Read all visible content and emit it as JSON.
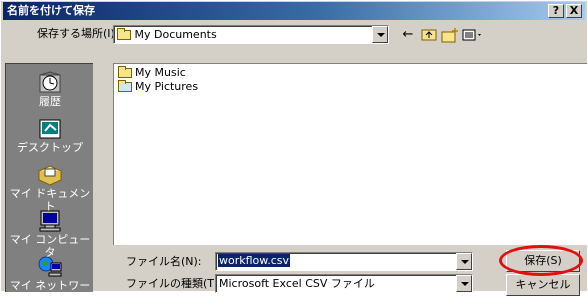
{
  "window": {
    "title": "名前を付けて保存",
    "help_button": "?",
    "close_button": "X"
  },
  "lookin": {
    "label": "保存する場所(I):",
    "value": "My Documents"
  },
  "toolbar": {
    "back_icon": "←",
    "up_folder_icon": "up-folder-icon",
    "new_folder_icon": "new-folder-icon",
    "views_icon": "views-icon"
  },
  "places": [
    {
      "label": "履歴",
      "icon": "history-icon"
    },
    {
      "label": "デスクトップ",
      "icon": "desktop-icon"
    },
    {
      "label": "マイ ドキュメント",
      "icon": "my-documents-icon"
    },
    {
      "label": "マイ コンピュータ",
      "icon": "my-computer-icon"
    },
    {
      "label": "マイ ネットワーク",
      "icon": "my-network-icon"
    }
  ],
  "files": [
    {
      "name": "My Music",
      "icon": "folder-icon"
    },
    {
      "name": "My Pictures",
      "icon": "pictures-folder-icon"
    }
  ],
  "filename": {
    "label": "ファイル名(N):",
    "value": "workflow.csv"
  },
  "filetype": {
    "label": "ファイルの種類(T):",
    "value": "Microsoft Excel CSV ファイル"
  },
  "buttons": {
    "save": "保存(S)",
    "cancel": "キャンセル"
  },
  "colors": {
    "title_bar": "#0a246a",
    "face": "#d4d0c8",
    "places_bar": "#808080",
    "highlight": "#0a246a",
    "annotation_ring": "#e01010"
  }
}
